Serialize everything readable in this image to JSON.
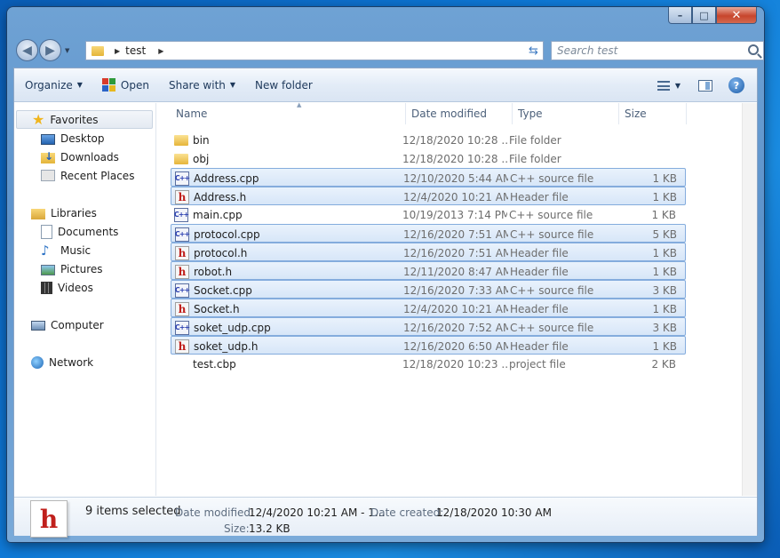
{
  "window": {
    "buttons": {
      "minimize": "–",
      "maximize": "□",
      "close": "✕"
    }
  },
  "address": {
    "path": [
      "test"
    ],
    "search_placeholder": "Search test"
  },
  "toolbar": {
    "organize": "Organize",
    "open": "Open",
    "share_with": "Share with",
    "new_folder": "New folder"
  },
  "nav": {
    "favorites": "Favorites",
    "desktop": "Desktop",
    "downloads": "Downloads",
    "recent": "Recent Places",
    "libraries": "Libraries",
    "documents": "Documents",
    "music": "Music",
    "pictures": "Pictures",
    "videos": "Videos",
    "computer": "Computer",
    "network": "Network"
  },
  "columns": {
    "name": "Name",
    "date": "Date modified",
    "type": "Type",
    "size": "Size"
  },
  "files": [
    {
      "name": "bin",
      "date": "12/18/2020 10:28 ...",
      "type": "File folder",
      "size": "",
      "icon": "folder",
      "selected": false
    },
    {
      "name": "obj",
      "date": "12/18/2020 10:28 ...",
      "type": "File folder",
      "size": "",
      "icon": "folder",
      "selected": false
    },
    {
      "name": "Address.cpp",
      "date": "12/10/2020 5:44 AM",
      "type": "C++ source file",
      "size": "1 KB",
      "icon": "cpp",
      "selected": true
    },
    {
      "name": "Address.h",
      "date": "12/4/2020 10:21 AM",
      "type": "Header file",
      "size": "1 KB",
      "icon": "h",
      "selected": true
    },
    {
      "name": "main.cpp",
      "date": "10/19/2013 7:14 PM",
      "type": "C++ source file",
      "size": "1 KB",
      "icon": "cpp",
      "selected": false
    },
    {
      "name": "protocol.cpp",
      "date": "12/16/2020 7:51 AM",
      "type": "C++ source file",
      "size": "5 KB",
      "icon": "cpp",
      "selected": true
    },
    {
      "name": "protocol.h",
      "date": "12/16/2020 7:51 AM",
      "type": "Header file",
      "size": "1 KB",
      "icon": "h",
      "selected": true
    },
    {
      "name": "robot.h",
      "date": "12/11/2020 8:47 AM",
      "type": "Header file",
      "size": "1 KB",
      "icon": "h",
      "selected": true
    },
    {
      "name": "Socket.cpp",
      "date": "12/16/2020 7:33 AM",
      "type": "C++ source file",
      "size": "3 KB",
      "icon": "cpp",
      "selected": true
    },
    {
      "name": "Socket.h",
      "date": "12/4/2020 10:21 AM",
      "type": "Header file",
      "size": "1 KB",
      "icon": "h",
      "selected": true
    },
    {
      "name": "soket_udp.cpp",
      "date": "12/16/2020 7:52 AM",
      "type": "C++ source file",
      "size": "3 KB",
      "icon": "cpp",
      "selected": true
    },
    {
      "name": "soket_udp.h",
      "date": "12/16/2020 6:50 AM",
      "type": "Header file",
      "size": "1 KB",
      "icon": "h",
      "selected": true
    },
    {
      "name": "test.cbp",
      "date": "12/18/2020 10:23 ...",
      "type": "project file",
      "size": "2 KB",
      "icon": "cbp",
      "selected": false
    }
  ],
  "details": {
    "selected_count": "9 items selected",
    "date_modified_label": "Date modified:",
    "date_modified_value": "12/4/2020 10:21 AM - 1...",
    "date_created_label": "Date created:",
    "date_created_value": "12/18/2020 10:30 AM",
    "size_label": "Size:",
    "size_value": "13.2 KB"
  }
}
